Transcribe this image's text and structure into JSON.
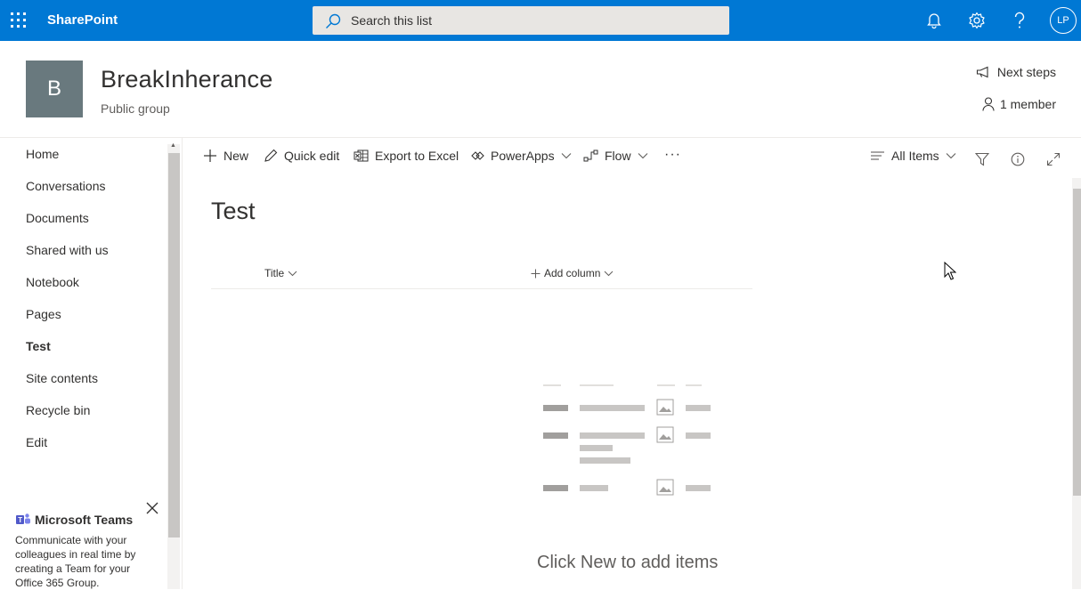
{
  "suitebar": {
    "brand": "SharePoint",
    "search_placeholder": "Search this list",
    "avatar_initials": "LP",
    "icons": [
      "app-launcher-icon",
      "search-icon",
      "bell-icon",
      "gear-icon",
      "help-icon"
    ],
    "background": "#0078d4"
  },
  "site": {
    "logo_letter": "B",
    "logo_color": "#69797e",
    "title": "BreakInherance",
    "subtitle": "Public group",
    "next_steps": "Next steps",
    "members": "1 member"
  },
  "nav": {
    "items": [
      {
        "label": "Home",
        "active": false
      },
      {
        "label": "Conversations",
        "active": false
      },
      {
        "label": "Documents",
        "active": false
      },
      {
        "label": "Shared with us",
        "active": false
      },
      {
        "label": "Notebook",
        "active": false
      },
      {
        "label": "Pages",
        "active": false
      },
      {
        "label": "Test",
        "active": true
      },
      {
        "label": "Site contents",
        "active": false
      },
      {
        "label": "Recycle bin",
        "active": false
      },
      {
        "label": "Edit",
        "active": false
      }
    ]
  },
  "teams_promo": {
    "title": "Microsoft Teams",
    "body": "Communicate with your colleagues in real time by creating a Team for your Office 365 Group."
  },
  "commandbar": {
    "new": "New",
    "quick_edit": "Quick edit",
    "export": "Export to Excel",
    "powerapps": "PowerApps",
    "flow": "Flow",
    "more": "···",
    "view": "All Items"
  },
  "list": {
    "title": "Test",
    "columns": {
      "title": "Title",
      "add": "Add column"
    },
    "empty_message": "Click New to add items"
  }
}
